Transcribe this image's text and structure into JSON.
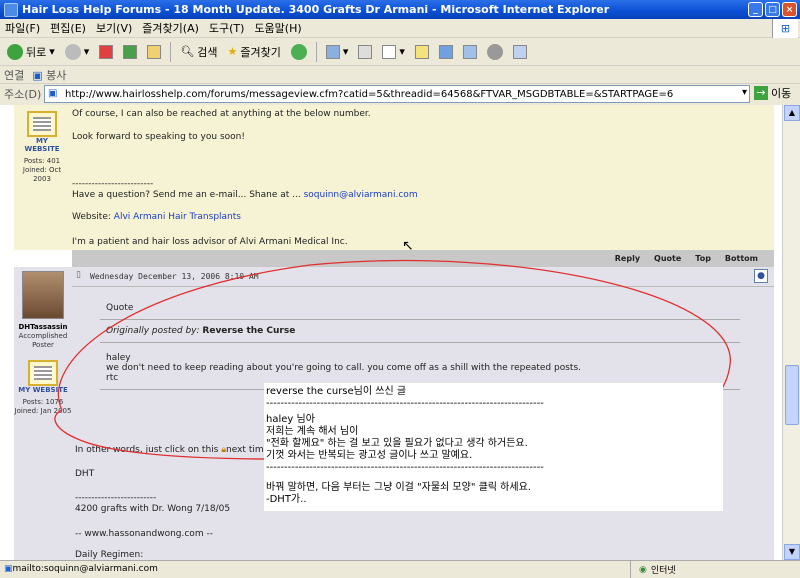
{
  "window": {
    "title": "Hair Loss Help Forums - 18 Month Update. 3400 Grafts Dr Armani - Microsoft Internet Explorer"
  },
  "menu": [
    "파일(F)",
    "편집(E)",
    "보기(V)",
    "즐겨찾기(A)",
    "도구(T)",
    "도움말(H)"
  ],
  "toolbar": {
    "back": "뒤로",
    "search": "검색",
    "favorites": "즐겨찾기"
  },
  "links": {
    "label": "연결",
    "item": "봉사"
  },
  "address": {
    "label": "주소(D)",
    "url": "http://www.hairlosshelp.com/forums/messageview.cfm?catid=5&threadid=64568&FTVAR_MSGDBTABLE=&STARTPAGE=6",
    "go": "이동"
  },
  "post1": {
    "website_label": "MY WEBSITE",
    "posts": "Posts: 401",
    "joined": "Joined: Oct 2003",
    "line1": "Of course, I can also be reached at anything at the below number.",
    "line2": "Look forward to speaking to you soon!",
    "separator": "-------------------------",
    "line3": "Have a question? Send me an e-mail... Shane at ...",
    "email": "soquinn@alviarmani.com",
    "website_prefix": "Website:",
    "website_link": "Alvi Armani Hair Transplants",
    "line4": "I'm a patient and hair loss advisor of Alvi Armani Medical Inc."
  },
  "actions": [
    "Reply",
    "Quote",
    "Top",
    "Bottom"
  ],
  "post2": {
    "date": "Wednesday December 13, 2006 8:10 AM",
    "user": "DHTassassin",
    "rank": "Accomplished Poster",
    "website_label": "MY WEBSITE",
    "posts": "Posts: 1076",
    "joined": "Joined: Jan 2005",
    "quote_label": "Quote",
    "posted_by_prefix": "Originally posted by:",
    "posted_by": "Reverse the Curse",
    "q1": "haley",
    "q2": "we don't need to keep reading about you're going to call. you come off as a shill with the repeated posts.",
    "q3": "rtc",
    "other": "In other words, just click on this",
    "other2": "next time.",
    "sig1": "DHT",
    "sig_sep": "-------------------------",
    "sig2": "4200 grafts with Dr. Wong 7/18/05",
    "sig3": "-- www.hassonandwong.com --",
    "sig4": "Daily Regimen:"
  },
  "overlay": {
    "l1": "reverse the curse님이 쓰신 글",
    "sep": "-----------------------------------------------------------------------------",
    "l2": "haley 님아",
    "l3": "저희는 계속 해서 님이",
    "l4": "\"전화 할께요\" 하는 걸 보고 있을 필요가 없다고 생각 하거든요.",
    "l5": "기껏 와서는 반복되는 광고성 글이나 쓰고 말예요.",
    "l6": "바꿔 말하면, 다음 부터는 그냥 이걸 \"자물쇠 모양\" 클릭 하세요.",
    "l7": "-DHT가.."
  },
  "status": {
    "text": "mailto:soquinn@alviarmani.com",
    "zone": "인터넷"
  },
  "colors": {
    "annotation": "#e03030",
    "post_bg": "#f6f3d5",
    "post2_bg": "#e3e2eb"
  }
}
